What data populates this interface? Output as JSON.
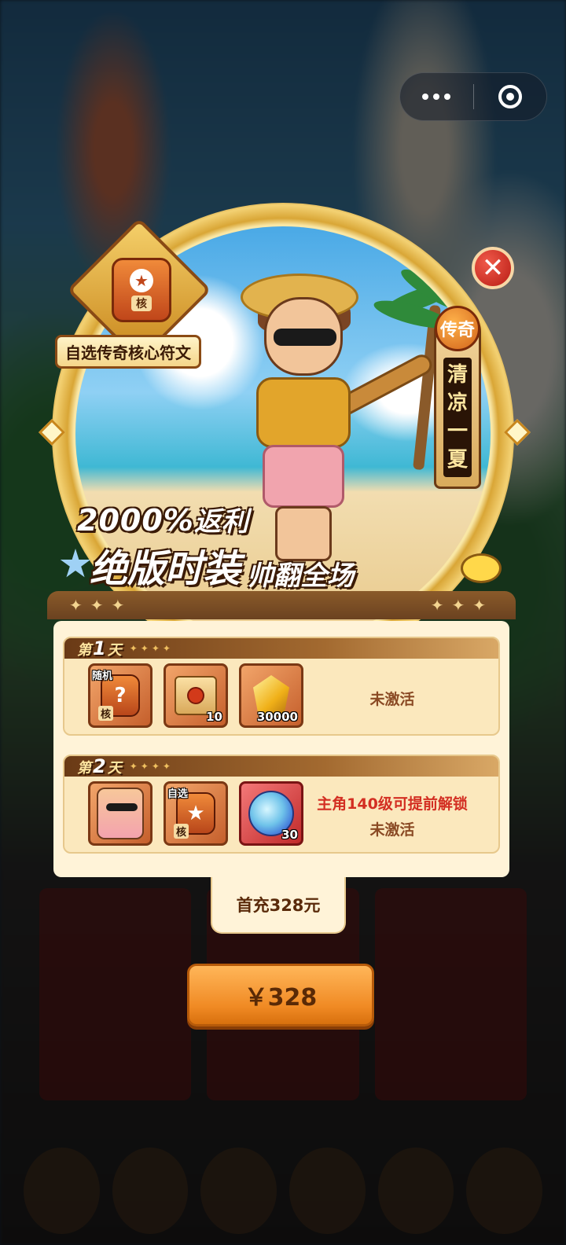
{
  "banner": {
    "badge_tag": "核",
    "badge_label": "自选传奇核心符文",
    "vertical_top": "传奇",
    "vertical_text": "清凉一夏",
    "headline_percent": "2000%",
    "headline_rebate": "返利",
    "headline_big": "绝版时装",
    "headline_small": "帅翻全场"
  },
  "days": [
    {
      "label_prefix": "第",
      "number": "1",
      "label_suffix": "天",
      "items": [
        {
          "name": "random-rune",
          "corner": "随机",
          "tag": "核",
          "qty": ""
        },
        {
          "name": "scroll",
          "corner": "",
          "tag": "",
          "qty": "10"
        },
        {
          "name": "gold-gem",
          "corner": "",
          "tag": "",
          "qty": "30000"
        }
      ],
      "status": "未激活",
      "unlock_note": ""
    },
    {
      "label_prefix": "第",
      "number": "2",
      "label_suffix": "天",
      "items": [
        {
          "name": "costume-avatar",
          "corner": "",
          "tag": "",
          "qty": ""
        },
        {
          "name": "select-rune",
          "corner": "自选",
          "tag": "核",
          "qty": ""
        },
        {
          "name": "blue-orb",
          "corner": "",
          "tag": "",
          "qty": "30"
        }
      ],
      "status": "未激活",
      "unlock_note": "主角140级可提前解锁"
    }
  ],
  "price": {
    "tab_label": "首充328元",
    "button_label": "￥328"
  },
  "colors": {
    "button": "#f08a24",
    "unlock_text": "#d32e22",
    "status_text": "#8a4a24"
  }
}
